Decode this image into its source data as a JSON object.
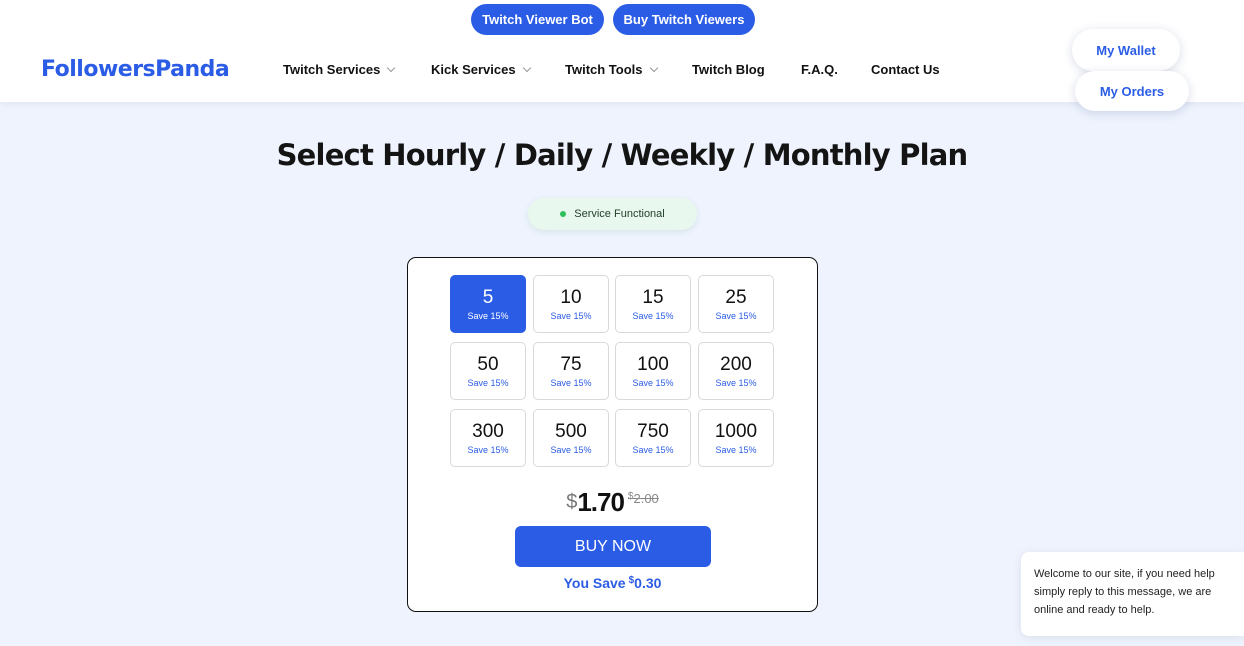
{
  "header": {
    "top_links": [
      "Twitch Viewer Bot",
      "Buy Twitch Viewers"
    ],
    "logo": "FollowersPanda",
    "nav": [
      {
        "label": "Twitch Services",
        "dropdown": true
      },
      {
        "label": "Kick Services",
        "dropdown": true
      },
      {
        "label": "Twitch Tools",
        "dropdown": true
      },
      {
        "label": "Twitch Blog",
        "dropdown": false
      },
      {
        "label": "F.A.Q.",
        "dropdown": false
      },
      {
        "label": "Contact Us",
        "dropdown": false
      }
    ],
    "wallet_label": "My Wallet",
    "orders_label": "My Orders"
  },
  "main": {
    "title": "Select Hourly / Daily / Weekly / Monthly Plan",
    "status": "Service Functional",
    "options": [
      {
        "qty": "5",
        "save": "Save 15%"
      },
      {
        "qty": "10",
        "save": "Save 15%"
      },
      {
        "qty": "15",
        "save": "Save 15%"
      },
      {
        "qty": "25",
        "save": "Save 15%"
      },
      {
        "qty": "50",
        "save": "Save 15%"
      },
      {
        "qty": "75",
        "save": "Save 15%"
      },
      {
        "qty": "100",
        "save": "Save 15%"
      },
      {
        "qty": "200",
        "save": "Save 15%"
      },
      {
        "qty": "300",
        "save": "Save 15%"
      },
      {
        "qty": "500",
        "save": "Save 15%"
      },
      {
        "qty": "750",
        "save": "Save 15%"
      },
      {
        "qty": "1000",
        "save": "Save 15%"
      }
    ],
    "selected_option": "5",
    "currency": "$",
    "price": "1.70",
    "old_price": "2.00",
    "buy_label": "BUY NOW",
    "you_save_label": "You Save",
    "you_save_amount": "0.30"
  },
  "chat": {
    "message": "Welcome to our site, if you need help simply reply to this message, we are online and ready to help."
  },
  "colors": {
    "accent": "#2b5ce6",
    "page_bg": "#eef3fd",
    "status_dot": "#2fbf5c",
    "status_bg": "#e9f8ee"
  }
}
